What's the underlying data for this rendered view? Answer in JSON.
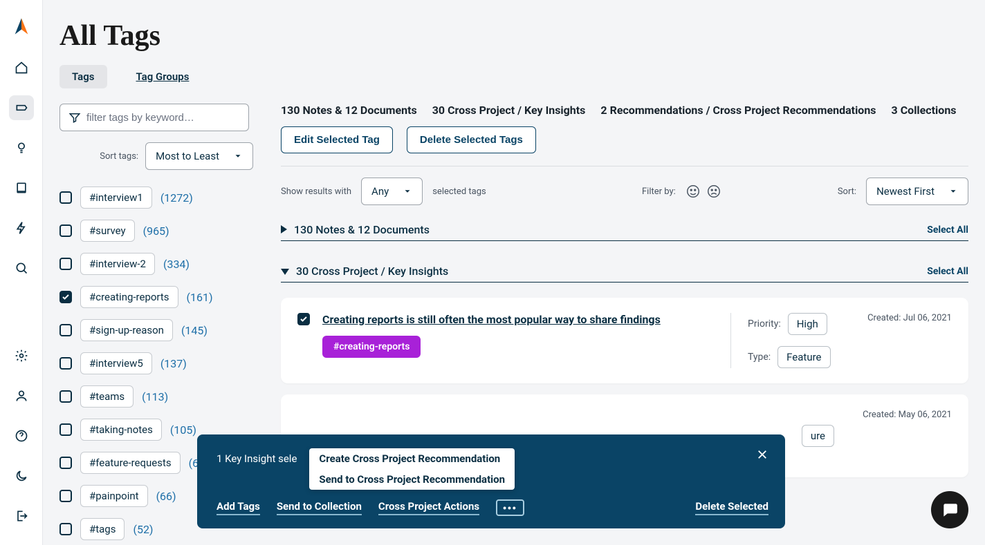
{
  "page": {
    "title": "All Tags"
  },
  "tabs": {
    "active": "Tags",
    "inactive": "Tag Groups"
  },
  "filter": {
    "placeholder": "filter tags by keyword…"
  },
  "sort_tags": {
    "label": "Sort tags:",
    "value": "Most to Least"
  },
  "tags": [
    {
      "name": "#interview1",
      "count": "(1272)",
      "checked": false
    },
    {
      "name": "#survey",
      "count": "(965)",
      "checked": false
    },
    {
      "name": "#interview-2",
      "count": "(334)",
      "checked": false
    },
    {
      "name": "#creating-reports",
      "count": "(161)",
      "checked": true
    },
    {
      "name": "#sign-up-reason",
      "count": "(145)",
      "checked": false
    },
    {
      "name": "#interview5",
      "count": "(137)",
      "checked": false
    },
    {
      "name": "#teams",
      "count": "(113)",
      "checked": false
    },
    {
      "name": "#taking-notes",
      "count": "(105)",
      "checked": false
    },
    {
      "name": "#feature-requests",
      "count": "(6",
      "checked": false
    },
    {
      "name": "#painpoint",
      "count": "(66)",
      "checked": false
    },
    {
      "name": "#tags",
      "count": "(52)",
      "checked": false
    }
  ],
  "stats": [
    "130 Notes & 12 Documents",
    "30 Cross Project / Key Insights",
    "2 Recommendations / Cross Project Recommendations",
    "3 Collections"
  ],
  "buttons": {
    "edit": "Edit Selected Tag",
    "delete": "Delete Selected Tags"
  },
  "results_filter": {
    "prefix": "Show results with",
    "value": "Any",
    "suffix": "selected tags",
    "filter_by": "Filter by:",
    "sort_label": "Sort:",
    "sort_value": "Newest First"
  },
  "sections": {
    "notes": {
      "title": "130 Notes & 12 Documents",
      "select_all": "Select All"
    },
    "insights": {
      "title": "30 Cross Project / Key Insights",
      "select_all": "Select All"
    }
  },
  "cards": [
    {
      "title": "Creating reports is still often the most popular way to share findings",
      "tag": "#creating-reports",
      "priority_label": "Priority:",
      "priority": "High",
      "type_label": "Type:",
      "type": "Feature",
      "created": "Created: Jul 06, 2021",
      "checked": true
    },
    {
      "created": "Created: May 06, 2021",
      "type_partial": "ure"
    }
  ],
  "actionbar": {
    "status": "1 Key Insight sele",
    "popup": [
      "Create Cross Project Recommendation",
      "Send to Cross Project Recommendation"
    ],
    "links": {
      "add_tags": "Add Tags",
      "send_collection": "Send to Collection",
      "cross_actions": "Cross Project Actions",
      "delete": "Delete Selected"
    }
  }
}
